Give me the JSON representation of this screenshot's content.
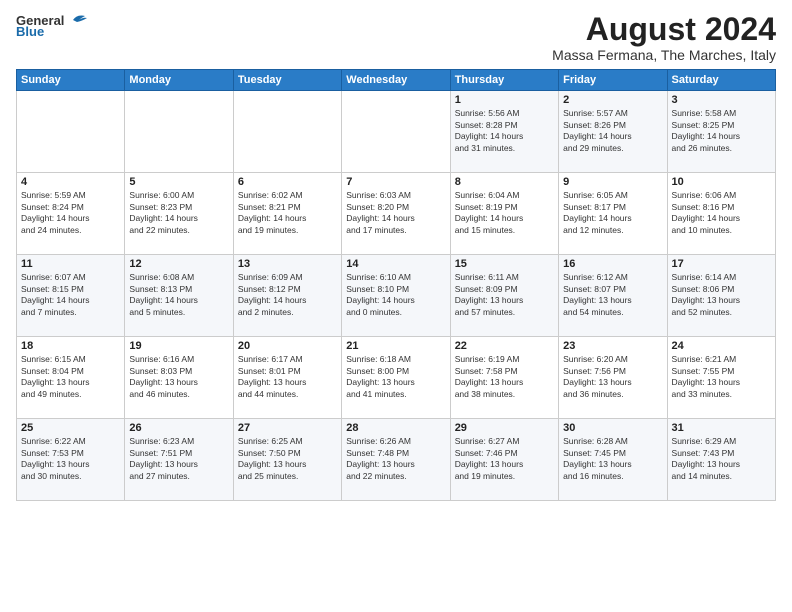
{
  "header": {
    "logo_general": "General",
    "logo_blue": "Blue",
    "month_year": "August 2024",
    "location": "Massa Fermana, The Marches, Italy"
  },
  "calendar": {
    "days_of_week": [
      "Sunday",
      "Monday",
      "Tuesday",
      "Wednesday",
      "Thursday",
      "Friday",
      "Saturday"
    ],
    "weeks": [
      [
        {
          "day": "",
          "text": ""
        },
        {
          "day": "",
          "text": ""
        },
        {
          "day": "",
          "text": ""
        },
        {
          "day": "",
          "text": ""
        },
        {
          "day": "1",
          "text": "Sunrise: 5:56 AM\nSunset: 8:28 PM\nDaylight: 14 hours\nand 31 minutes."
        },
        {
          "day": "2",
          "text": "Sunrise: 5:57 AM\nSunset: 8:26 PM\nDaylight: 14 hours\nand 29 minutes."
        },
        {
          "day": "3",
          "text": "Sunrise: 5:58 AM\nSunset: 8:25 PM\nDaylight: 14 hours\nand 26 minutes."
        }
      ],
      [
        {
          "day": "4",
          "text": "Sunrise: 5:59 AM\nSunset: 8:24 PM\nDaylight: 14 hours\nand 24 minutes."
        },
        {
          "day": "5",
          "text": "Sunrise: 6:00 AM\nSunset: 8:23 PM\nDaylight: 14 hours\nand 22 minutes."
        },
        {
          "day": "6",
          "text": "Sunrise: 6:02 AM\nSunset: 8:21 PM\nDaylight: 14 hours\nand 19 minutes."
        },
        {
          "day": "7",
          "text": "Sunrise: 6:03 AM\nSunset: 8:20 PM\nDaylight: 14 hours\nand 17 minutes."
        },
        {
          "day": "8",
          "text": "Sunrise: 6:04 AM\nSunset: 8:19 PM\nDaylight: 14 hours\nand 15 minutes."
        },
        {
          "day": "9",
          "text": "Sunrise: 6:05 AM\nSunset: 8:17 PM\nDaylight: 14 hours\nand 12 minutes."
        },
        {
          "day": "10",
          "text": "Sunrise: 6:06 AM\nSunset: 8:16 PM\nDaylight: 14 hours\nand 10 minutes."
        }
      ],
      [
        {
          "day": "11",
          "text": "Sunrise: 6:07 AM\nSunset: 8:15 PM\nDaylight: 14 hours\nand 7 minutes."
        },
        {
          "day": "12",
          "text": "Sunrise: 6:08 AM\nSunset: 8:13 PM\nDaylight: 14 hours\nand 5 minutes."
        },
        {
          "day": "13",
          "text": "Sunrise: 6:09 AM\nSunset: 8:12 PM\nDaylight: 14 hours\nand 2 minutes."
        },
        {
          "day": "14",
          "text": "Sunrise: 6:10 AM\nSunset: 8:10 PM\nDaylight: 14 hours\nand 0 minutes."
        },
        {
          "day": "15",
          "text": "Sunrise: 6:11 AM\nSunset: 8:09 PM\nDaylight: 13 hours\nand 57 minutes."
        },
        {
          "day": "16",
          "text": "Sunrise: 6:12 AM\nSunset: 8:07 PM\nDaylight: 13 hours\nand 54 minutes."
        },
        {
          "day": "17",
          "text": "Sunrise: 6:14 AM\nSunset: 8:06 PM\nDaylight: 13 hours\nand 52 minutes."
        }
      ],
      [
        {
          "day": "18",
          "text": "Sunrise: 6:15 AM\nSunset: 8:04 PM\nDaylight: 13 hours\nand 49 minutes."
        },
        {
          "day": "19",
          "text": "Sunrise: 6:16 AM\nSunset: 8:03 PM\nDaylight: 13 hours\nand 46 minutes."
        },
        {
          "day": "20",
          "text": "Sunrise: 6:17 AM\nSunset: 8:01 PM\nDaylight: 13 hours\nand 44 minutes."
        },
        {
          "day": "21",
          "text": "Sunrise: 6:18 AM\nSunset: 8:00 PM\nDaylight: 13 hours\nand 41 minutes."
        },
        {
          "day": "22",
          "text": "Sunrise: 6:19 AM\nSunset: 7:58 PM\nDaylight: 13 hours\nand 38 minutes."
        },
        {
          "day": "23",
          "text": "Sunrise: 6:20 AM\nSunset: 7:56 PM\nDaylight: 13 hours\nand 36 minutes."
        },
        {
          "day": "24",
          "text": "Sunrise: 6:21 AM\nSunset: 7:55 PM\nDaylight: 13 hours\nand 33 minutes."
        }
      ],
      [
        {
          "day": "25",
          "text": "Sunrise: 6:22 AM\nSunset: 7:53 PM\nDaylight: 13 hours\nand 30 minutes."
        },
        {
          "day": "26",
          "text": "Sunrise: 6:23 AM\nSunset: 7:51 PM\nDaylight: 13 hours\nand 27 minutes."
        },
        {
          "day": "27",
          "text": "Sunrise: 6:25 AM\nSunset: 7:50 PM\nDaylight: 13 hours\nand 25 minutes."
        },
        {
          "day": "28",
          "text": "Sunrise: 6:26 AM\nSunset: 7:48 PM\nDaylight: 13 hours\nand 22 minutes."
        },
        {
          "day": "29",
          "text": "Sunrise: 6:27 AM\nSunset: 7:46 PM\nDaylight: 13 hours\nand 19 minutes."
        },
        {
          "day": "30",
          "text": "Sunrise: 6:28 AM\nSunset: 7:45 PM\nDaylight: 13 hours\nand 16 minutes."
        },
        {
          "day": "31",
          "text": "Sunrise: 6:29 AM\nSunset: 7:43 PM\nDaylight: 13 hours\nand 14 minutes."
        }
      ]
    ]
  }
}
